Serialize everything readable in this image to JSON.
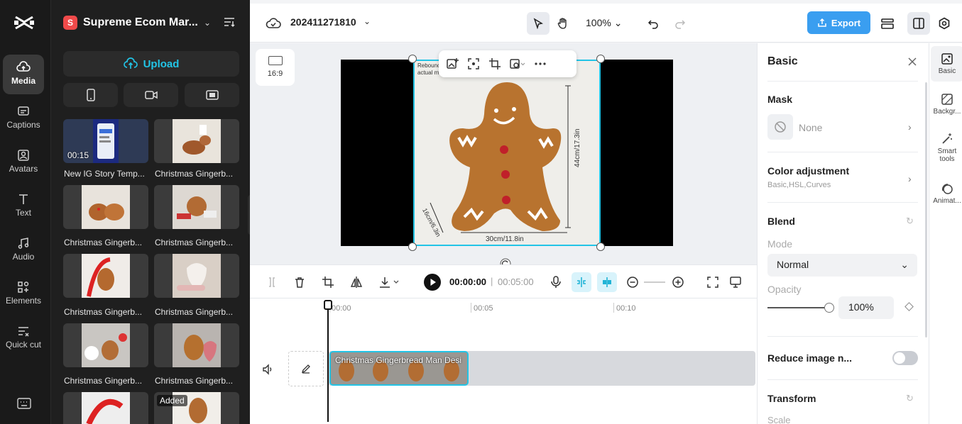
{
  "rail": {
    "items": [
      {
        "label": "Media",
        "icon": "media-cloud-icon",
        "active": true
      },
      {
        "label": "Captions",
        "icon": "captions-icon"
      },
      {
        "label": "Avatars",
        "icon": "avatars-icon"
      },
      {
        "label": "Text",
        "icon": "text-icon"
      },
      {
        "label": "Audio",
        "icon": "audio-icon"
      },
      {
        "label": "Elements",
        "icon": "elements-icon"
      },
      {
        "label": "Quick cut",
        "icon": "quick-cut-icon"
      }
    ]
  },
  "workspace": {
    "badge": "S",
    "name": "Supreme Ecom Mar..."
  },
  "media": {
    "upload_label": "Upload",
    "items": [
      {
        "caption": "New IG Story Temp...",
        "duration": "00:15"
      },
      {
        "caption": "Christmas Gingerb..."
      },
      {
        "caption": "Christmas Gingerb..."
      },
      {
        "caption": "Christmas Gingerb..."
      },
      {
        "caption": "Christmas Gingerb..."
      },
      {
        "caption": "Christmas Gingerb..."
      },
      {
        "caption": "Christmas Gingerb..."
      },
      {
        "caption": "Christmas Gingerb..."
      },
      {
        "caption": ""
      },
      {
        "caption": "",
        "badge": "Added"
      }
    ]
  },
  "topbar": {
    "project_name": "202411271810",
    "zoom": "100%",
    "export_label": "Export"
  },
  "canvas": {
    "ratio_label": "16:9",
    "image_top_text": "Rebounc… r,\nactual m…",
    "dim_height": "44cm/17.3in",
    "dim_width": "30cm/11.8in",
    "dim_depth": "16cm/6.3in"
  },
  "player": {
    "current_time": "00:00:00",
    "separator": "|",
    "total_time": "00:05:00"
  },
  "timeline": {
    "ticks": [
      "00:00",
      "00:05",
      "00:10"
    ],
    "clip_label": "Christmas Gingerbread Man Desi"
  },
  "panel": {
    "title": "Basic",
    "mask": {
      "heading": "Mask",
      "value": "None"
    },
    "color_adjustment": {
      "heading": "Color adjustment",
      "sub": "Basic,HSL,Curves"
    },
    "blend": {
      "heading": "Blend",
      "mode_label": "Mode",
      "mode_value": "Normal",
      "opacity_label": "Opacity",
      "opacity_value": "100%",
      "opacity_level": 1.0
    },
    "reduce_noise": {
      "label": "Reduce image n...",
      "enabled": false
    },
    "transform": {
      "heading": "Transform",
      "scale_label": "Scale"
    }
  },
  "tabs": [
    {
      "label": "Basic",
      "icon": "basic-icon",
      "active": true
    },
    {
      "label": "Backgr...",
      "icon": "background-icon"
    },
    {
      "label": "Smart tools",
      "icon": "smart-tools-icon"
    },
    {
      "label": "Animat...",
      "icon": "animation-icon"
    }
  ],
  "colors": {
    "accent": "#22c4e6",
    "export": "#3a9ef0",
    "workspace_badge": "#f04a4a"
  }
}
